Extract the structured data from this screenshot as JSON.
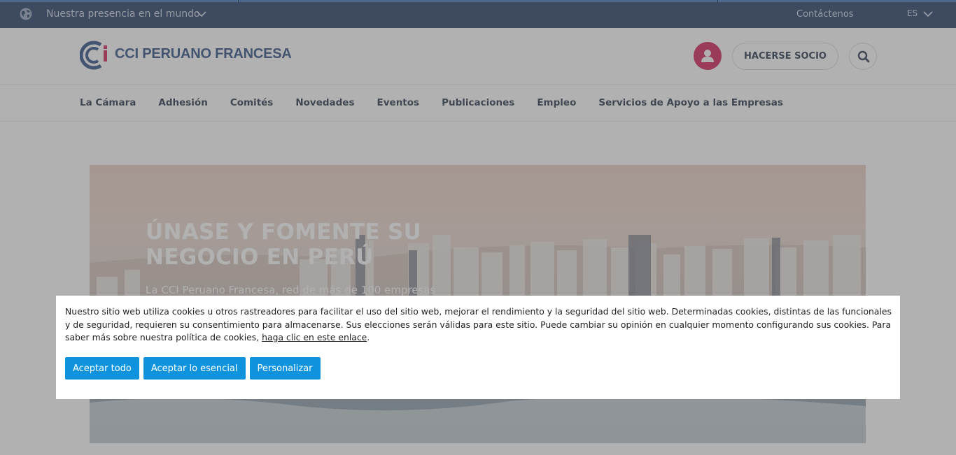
{
  "topbar": {
    "world_label": "Nuestra presencia en el mundo",
    "contact_label": "Contáctenos",
    "language": "ES"
  },
  "header": {
    "logo_text": "CCI PERUANO FRANCESA",
    "join_label": "HACERSE SOCIO",
    "icons": [
      "globe-icon",
      "chevron-down-icon",
      "user-icon",
      "search-icon"
    ],
    "colors": {
      "topbar": "#16315a",
      "brand_blue": "#21447c",
      "accent_red": "#d0154d"
    }
  },
  "nav": {
    "items": [
      {
        "label": "La Cámara"
      },
      {
        "label": "Adhesión"
      },
      {
        "label": "Comités"
      },
      {
        "label": "Novedades"
      },
      {
        "label": "Eventos"
      },
      {
        "label": "Publicaciones"
      },
      {
        "label": "Empleo"
      },
      {
        "label": "Servicios de Apoyo a las Empresas"
      }
    ]
  },
  "hero": {
    "title": "ÚNASE Y FOMENTE SU NEGOCIO EN PERÚ",
    "subtitle": "La CCI Peruano Francesa, red de más de 100 empresas"
  },
  "cookie": {
    "message": "Nuestro sitio web utiliza cookies u otros rastreadores para facilitar el uso del sitio web, mejorar el rendimiento y la seguridad del sitio web. Determinadas cookies, distintas de las funcionales y de seguridad, requieren su consentimiento para almacenarse. Sus elecciones serán válidas para este sitio. Puede cambiar su opinión en cualquier momento configurando sus cookies. Para saber más sobre nuestra política de cookies, ",
    "link_text": "haga clic en este enlace",
    "message_end": ".",
    "accept_all": "Aceptar todo",
    "accept_essential": "Aceptar lo esencial",
    "customize": "Personalizar",
    "button_color": "#0f93dc"
  }
}
